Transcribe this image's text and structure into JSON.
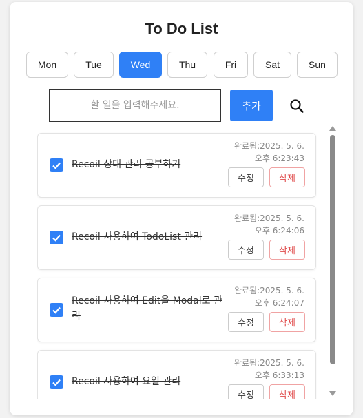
{
  "title": "To Do List",
  "days": [
    {
      "label": "Mon",
      "active": false
    },
    {
      "label": "Tue",
      "active": false
    },
    {
      "label": "Wed",
      "active": true
    },
    {
      "label": "Thu",
      "active": false
    },
    {
      "label": "Fri",
      "active": false
    },
    {
      "label": "Sat",
      "active": false
    },
    {
      "label": "Sun",
      "active": false
    }
  ],
  "input": {
    "placeholder": "할 일을 입력해주세요.",
    "value": ""
  },
  "add_label": "추가",
  "search_icon": "search-icon",
  "todos": [
    {
      "text": "Recoil 상태 관리 공부하기",
      "checked": true,
      "completed_line1": "완료됨:2025. 5. 6.",
      "completed_line2": "오후 6:23:43",
      "edit_label": "수정",
      "delete_label": "삭제"
    },
    {
      "text": "Recoil 사용하여 TodoList 관리",
      "checked": true,
      "completed_line1": "완료됨:2025. 5. 6.",
      "completed_line2": "오후 6:24:06",
      "edit_label": "수정",
      "delete_label": "삭제"
    },
    {
      "text": "Recoil 사용하여 Edit을 Modal로 관리",
      "checked": true,
      "completed_line1": "완료됨:2025. 5. 6.",
      "completed_line2": "오후 6:24:07",
      "edit_label": "수정",
      "delete_label": "삭제"
    },
    {
      "text": "Recoil 사용하여 요일 관리",
      "checked": true,
      "completed_line1": "완료됨:2025. 5. 6.",
      "completed_line2": "오후 6:33:13",
      "edit_label": "수정",
      "delete_label": "삭제"
    }
  ],
  "colors": {
    "accent": "#2f80f6",
    "danger": "#e04b4b"
  }
}
